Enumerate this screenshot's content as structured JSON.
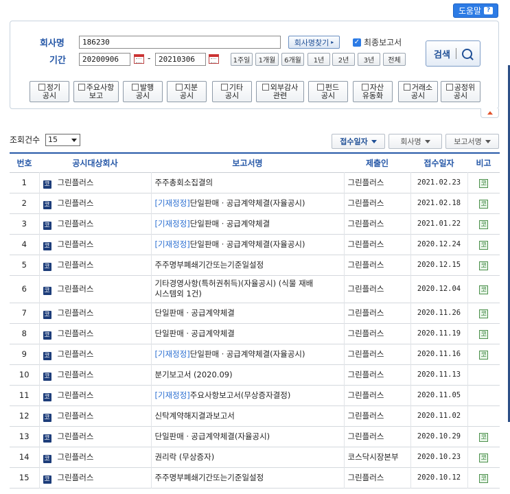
{
  "help": {
    "label": "도움말",
    "icon": "?"
  },
  "search": {
    "company_label": "회사명",
    "company_value": "186230",
    "find_company_label": "회사명찾기",
    "final_report_label": "최종보고서",
    "final_report_checked": true,
    "period_label": "기간",
    "date_from": "20200906",
    "date_to": "20210306",
    "date_sep": "-",
    "ranges": [
      "1주일",
      "1개월",
      "6개월",
      "1년",
      "2년",
      "3년",
      "전체"
    ],
    "search_label": "검색",
    "categories": [
      [
        "정기",
        "공시"
      ],
      [
        "주요사항",
        "보고"
      ],
      [
        "발행",
        "공시"
      ],
      [
        "지분",
        "공시"
      ],
      [
        "기타",
        "공시"
      ],
      [
        "외부감사",
        "관련"
      ],
      [
        "펀드",
        "공시"
      ],
      [
        "자산",
        "유동화"
      ],
      [
        "거래소",
        "공시"
      ],
      [
        "공정위",
        "공시"
      ]
    ]
  },
  "list_controls": {
    "count_label": "조회건수",
    "count_value": "15",
    "sort_buttons": [
      "접수일자",
      "회사명",
      "보고서명"
    ]
  },
  "table": {
    "headers": [
      "번호",
      "공시대상회사",
      "보고서명",
      "제출인",
      "접수일자",
      "비고"
    ],
    "company_badge": "코",
    "remark_badge": "코",
    "rows": [
      {
        "no": "1",
        "company": "그린플러스",
        "tag": "",
        "report": "주주총회소집결의",
        "report2": "",
        "submitter": "그린플러스",
        "date": "2021.02.23",
        "remark": true
      },
      {
        "no": "2",
        "company": "그린플러스",
        "tag": "[기재정정]",
        "report": "단일판매ㆍ공급계약체결(자율공시)",
        "report2": "",
        "submitter": "그린플러스",
        "date": "2021.02.18",
        "remark": true
      },
      {
        "no": "3",
        "company": "그린플러스",
        "tag": "[기재정정]",
        "report": "단일판매ㆍ공급계약체결",
        "report2": "",
        "submitter": "그린플러스",
        "date": "2021.01.22",
        "remark": true
      },
      {
        "no": "4",
        "company": "그린플러스",
        "tag": "[기재정정]",
        "report": "단일판매ㆍ공급계약체결(자율공시)",
        "report2": "",
        "submitter": "그린플러스",
        "date": "2020.12.24",
        "remark": true
      },
      {
        "no": "5",
        "company": "그린플러스",
        "tag": "",
        "report": "주주명부폐쇄기간또는기준일설정",
        "report2": "",
        "submitter": "그린플러스",
        "date": "2020.12.15",
        "remark": true
      },
      {
        "no": "6",
        "company": "그린플러스",
        "tag": "",
        "report": "기타경영사항(특허권취득)(자율공시) (식물 재배",
        "report2": "시스템외 1건)",
        "submitter": "그린플러스",
        "date": "2020.12.04",
        "remark": true
      },
      {
        "no": "7",
        "company": "그린플러스",
        "tag": "",
        "report": "단일판매ㆍ공급계약체결",
        "report2": "",
        "submitter": "그린플러스",
        "date": "2020.11.26",
        "remark": true
      },
      {
        "no": "8",
        "company": "그린플러스",
        "tag": "",
        "report": "단일판매ㆍ공급계약체결",
        "report2": "",
        "submitter": "그린플러스",
        "date": "2020.11.19",
        "remark": true
      },
      {
        "no": "9",
        "company": "그린플러스",
        "tag": "[기재정정]",
        "report": "단일판매ㆍ공급계약체결(자율공시)",
        "report2": "",
        "submitter": "그린플러스",
        "date": "2020.11.16",
        "remark": true
      },
      {
        "no": "10",
        "company": "그린플러스",
        "tag": "",
        "report": "분기보고서 (2020.09)",
        "report2": "",
        "submitter": "그린플러스",
        "date": "2020.11.13",
        "remark": false
      },
      {
        "no": "11",
        "company": "그린플러스",
        "tag": "[기재정정]",
        "report": "주요사항보고서(무상증자결정)",
        "report2": "",
        "submitter": "그린플러스",
        "date": "2020.11.05",
        "remark": false
      },
      {
        "no": "12",
        "company": "그린플러스",
        "tag": "",
        "report": "신탁계약해지결과보고서",
        "report2": "",
        "submitter": "그린플러스",
        "date": "2020.11.02",
        "remark": false
      },
      {
        "no": "13",
        "company": "그린플러스",
        "tag": "",
        "report": "단일판매ㆍ공급계약체결(자율공시)",
        "report2": "",
        "submitter": "그린플러스",
        "date": "2020.10.29",
        "remark": true
      },
      {
        "no": "14",
        "company": "그린플러스",
        "tag": "",
        "report": "권리락 (무상증자)",
        "report2": "",
        "submitter": "코스닥시장본부",
        "date": "2020.10.23",
        "remark": true
      },
      {
        "no": "15",
        "company": "그린플러스",
        "tag": "",
        "report": "주주명부폐쇄기간또는기준일설정",
        "report2": "",
        "submitter": "그린플러스",
        "date": "2020.10.12",
        "remark": true
      }
    ]
  }
}
